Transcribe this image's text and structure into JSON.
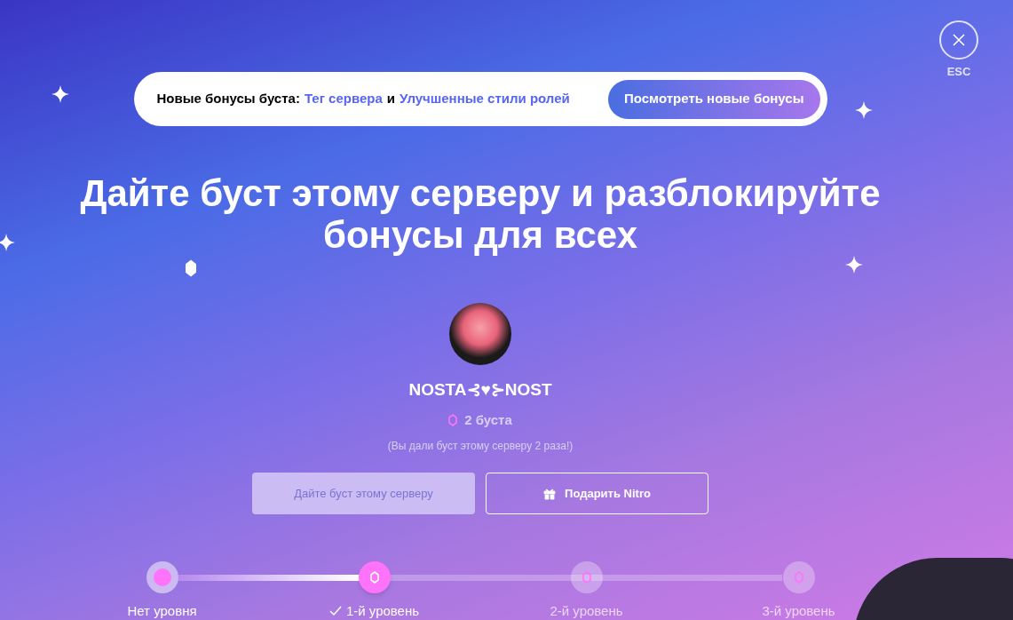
{
  "close": {
    "label": "ESC"
  },
  "banner": {
    "prefix": "Новые бонусы буста:",
    "link_1": "Тег сервера",
    "joiner": "и",
    "link_2": "Улучшенные стили ролей",
    "button": "Посмотреть новые бонусы"
  },
  "heading": "Дайте буст этому серверу и разблокируйте бонусы для всех",
  "server": {
    "name": "NOSTA⊰♥⊱NOST",
    "boosts": "2 буста",
    "note": "(Вы дали буст этому серверу 2 раза!)"
  },
  "buttons": [
    {
      "kind": "boost",
      "label": "Дайте буст этому серверу",
      "disabled": true
    },
    {
      "kind": "gift",
      "label": "Подарить Nitro",
      "disabled": false
    }
  ],
  "progress": {
    "level": 0.3
  },
  "levels": [
    {
      "label": "Нет уровня",
      "reached": true,
      "selected": false
    },
    {
      "label": "1-й уровень",
      "reached": true,
      "selected": true
    },
    {
      "label": "2-й уровень",
      "reached": false,
      "selected": false
    },
    {
      "label": "3-й уровень",
      "reached": false,
      "selected": false
    }
  ]
}
